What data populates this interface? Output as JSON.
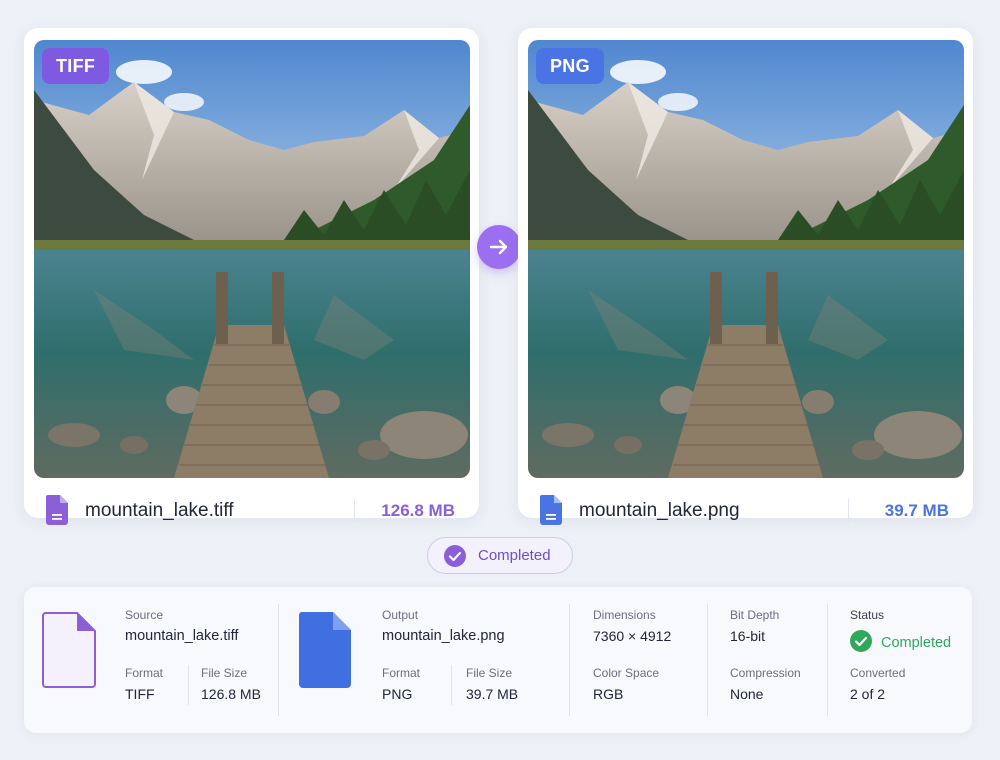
{
  "source": {
    "badge": "TIFF",
    "filename": "mountain_lake.tiff",
    "size": "126.8 MB",
    "file_icon": "file-doc-icon",
    "color": "#7d5ae0"
  },
  "output": {
    "badge": "PNG",
    "filename": "mountain_lake.png",
    "size": "39.7 MB",
    "file_icon": "file-doc-icon",
    "color": "#4a73e4"
  },
  "convert_arrow_icon": "arrow-right-icon",
  "status_pill": {
    "label": "Completed",
    "icon": "check-circle-icon",
    "color": "#7d5ae0"
  },
  "details": {
    "source": {
      "title_label": "Source",
      "filename": "mountain_lake.tiff",
      "format_label": "Format",
      "format": "TIFF",
      "size_label": "File Size",
      "size": "126.8 MB"
    },
    "output": {
      "title_label": "Output",
      "filename": "mountain_lake.png",
      "format_label": "Format",
      "format": "PNG",
      "size_label": "File Size",
      "size": "39.7 MB"
    },
    "dimensions_label": "Dimensions",
    "dimensions": "7360 × 4912",
    "color_space_label": "Color Space",
    "color_space": "RGB",
    "bit_depth_label": "Bit Depth",
    "bit_depth": "16-bit",
    "compression_label": "Compression",
    "compression": "None",
    "status_label": "Status",
    "status": "Completed",
    "status_color": "#2fa85c",
    "converted_label": "Converted",
    "converted": "2 of 2"
  }
}
